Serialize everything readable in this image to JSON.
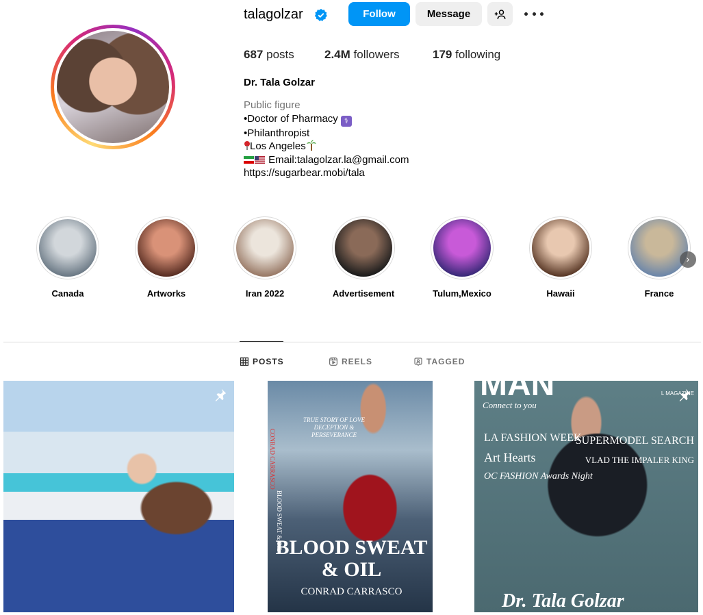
{
  "profile": {
    "username": "talagolzar",
    "follow_label": "Follow",
    "message_label": "Message",
    "posts_count": "687",
    "posts_label": "posts",
    "followers_count": "2.4M",
    "followers_label": "followers",
    "following_count": "179",
    "following_label": "following",
    "full_name": "Dr. Tala Golzar",
    "category": "Public figure",
    "bio_line1": "•Doctor of Pharmacy",
    "bio_line2": "•Philanthropist",
    "bio_line3": "Los Angeles",
    "bio_line4": "Email:talagolzar.la@gmail.com",
    "link": "https://sugarbear.mobi/tala",
    "icons": [
      "verified-badge-icon",
      "add-user-icon",
      "more-options-icon"
    ],
    "accent_color": "#0095f6"
  },
  "highlights": [
    {
      "label": "Canada",
      "colors": [
        "#6c7a86",
        "#d2d7db"
      ]
    },
    {
      "label": "Artworks",
      "colors": [
        "#5a2f24",
        "#d99278"
      ]
    },
    {
      "label": "Iran 2022",
      "colors": [
        "#9a7b68",
        "#ece5dc"
      ]
    },
    {
      "label": "Advertisement",
      "colors": [
        "#1c1c1c",
        "#8a6a58"
      ]
    },
    {
      "label": "Tulum,Mexico",
      "colors": [
        "#3b2a7a",
        "#c85ad8"
      ]
    },
    {
      "label": "Hawaii",
      "colors": [
        "#5b3a28",
        "#e8c8b0"
      ]
    },
    {
      "label": "France",
      "colors": [
        "#6d87a9",
        "#c9b89a"
      ]
    }
  ],
  "tabs": [
    {
      "label": "POSTS",
      "active": true,
      "icon": "grid-icon"
    },
    {
      "label": "REELS",
      "active": false,
      "icon": "reels-icon"
    },
    {
      "label": "TAGGED",
      "active": false,
      "icon": "tagged-icon"
    }
  ],
  "posts": [
    {
      "pinned": true
    },
    {
      "pinned": false,
      "cover_tagline": "TRUE STORY OF LOVE DECEPTION & PERSEVERANCE",
      "cover_spine_red": "CONRAD CARRASCO",
      "cover_spine_white": "BLOOD SWEAT & OIL",
      "cover_title": "BLOOD SWEAT & OIL",
      "cover_author": "CONRAD CARRASCO"
    },
    {
      "pinned": true,
      "mag_title": "MAN",
      "mag_sub": "Connect to you",
      "mag_tag": "L MAGAZINE",
      "mag_left": "LA FASHION WEEK",
      "mag_left2": "Art Hearts",
      "mag_left3": "OC FASHION Awards Night",
      "mag_right": "SUPERMODEL SEARCH",
      "mag_right2": "VLAD THE IMPALER KING",
      "mag_foot": "Dr. Tala Golzar"
    }
  ]
}
